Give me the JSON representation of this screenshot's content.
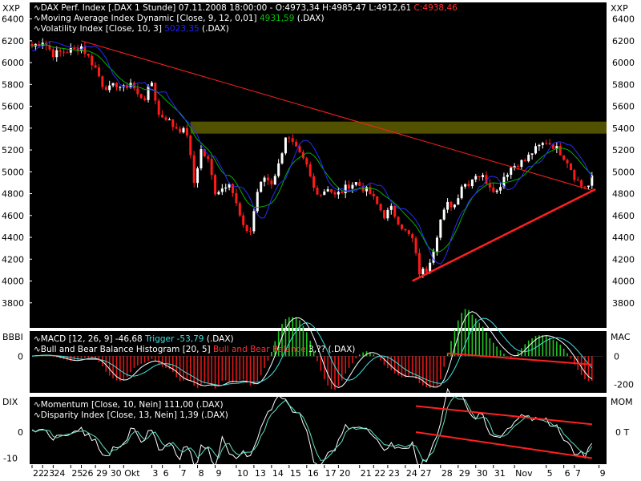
{
  "panel_codes": {
    "price_left": "XXP",
    "price_right": "XXP",
    "bb_left": "BBBI",
    "bb_right": "MAC",
    "mom_left": "DIX",
    "mom_right": "MOM"
  },
  "headers": {
    "price": [
      {
        "name": "DAX Perf. Index [.DAX  1 Stunde]",
        "info": " 07.11.2008 18:00:00 - O:4973,34 H:4985,47 L:4912,61 ",
        "last": "C:4938,46",
        "color": "#ffffff",
        "last_color": "#ff3030"
      },
      {
        "name": "Moving Average Index Dynamic [Close, 9, 12, 0,01]",
        "info": " ",
        "last": "4931,59",
        "color": "#ffffff",
        "last_color": "#00c800",
        "suffix": " (.DAX)"
      },
      {
        "name": "Volatility Index [Close, 10, 3]",
        "info": " ",
        "last": "5023,35",
        "color": "#ffffff",
        "last_color": "#2020ff",
        "suffix": " (.DAX)"
      }
    ],
    "bb": [
      {
        "name": "MACD [12, 26, 9]",
        "info": " -46,68 ",
        "last": "Trigger -53,79",
        "color": "#ffffff",
        "last_color": "#40e0e0",
        "suffix": " (.DAX)"
      },
      {
        "name": "Bull and Bear Balance Histogram [20, 5]",
        "info": " ",
        "last": "Bull and Bear Balance",
        "color": "#ffffff",
        "last_color": "#ff3030",
        "suffix": " 3,?? (.DAX)"
      }
    ],
    "mom": [
      {
        "name": "Momentum [Close, 10, Nein]",
        "info": " 111,00",
        "last": "",
        "color": "#ffffff",
        "last_color": "#ffffff",
        "suffix": " (.DAX)"
      },
      {
        "name": "Disparity Index [Close, 13, Nein]",
        "info": " 1,39",
        "last": "",
        "color": "#ffffff",
        "last_color": "#ffffff",
        "suffix": " (.DAX)"
      }
    ]
  },
  "chart_data": [
    {
      "type": "candlestick",
      "title": "DAX Perf. Index [.DAX  1 Stunde]",
      "ylim": [
        3600,
        6500
      ],
      "y_ticks": [
        "6400",
        "6200",
        "6000",
        "5800",
        "5600",
        "5400",
        "5200",
        "5000",
        "4800",
        "4600",
        "4400",
        "4200",
        "4000",
        "3800"
      ],
      "y_tick_values": [
        6400,
        6200,
        6000,
        5800,
        5600,
        5400,
        5200,
        5000,
        4800,
        4600,
        4400,
        4200,
        4000,
        3800
      ],
      "close_path": [
        [
          0,
          6150
        ],
        [
          3,
          6200
        ],
        [
          6,
          6080
        ],
        [
          9,
          6100
        ],
        [
          12,
          6120
        ],
        [
          14,
          6150
        ],
        [
          16,
          6050
        ],
        [
          18,
          5950
        ],
        [
          20,
          5800
        ],
        [
          22,
          5760
        ],
        [
          24,
          5800
        ],
        [
          26,
          5760
        ],
        [
          28,
          5820
        ],
        [
          30,
          5700
        ],
        [
          32,
          5680
        ],
        [
          34,
          5820
        ],
        [
          36,
          5520
        ],
        [
          38,
          5500
        ],
        [
          40,
          5420
        ],
        [
          42,
          5390
        ],
        [
          44,
          5350
        ],
        [
          46,
          4900
        ],
        [
          48,
          5200
        ],
        [
          50,
          5100
        ],
        [
          52,
          4820
        ],
        [
          54,
          4850
        ],
        [
          56,
          4920
        ],
        [
          58,
          4700
        ],
        [
          60,
          4480
        ],
        [
          62,
          4460
        ],
        [
          64,
          4820
        ],
        [
          66,
          4950
        ],
        [
          68,
          4900
        ],
        [
          70,
          5060
        ],
        [
          72,
          5330
        ],
        [
          74,
          5250
        ],
        [
          76,
          5150
        ],
        [
          78,
          5050
        ],
        [
          80,
          4850
        ],
        [
          82,
          4800
        ],
        [
          84,
          4860
        ],
        [
          86,
          4780
        ],
        [
          88,
          4820
        ],
        [
          90,
          4880
        ],
        [
          92,
          4900
        ],
        [
          94,
          4850
        ],
        [
          96,
          4800
        ],
        [
          98,
          4700
        ],
        [
          100,
          4600
        ],
        [
          102,
          4660
        ],
        [
          104,
          4550
        ],
        [
          106,
          4450
        ],
        [
          108,
          4380
        ],
        [
          110,
          4080
        ],
        [
          112,
          4100
        ],
        [
          114,
          4300
        ],
        [
          116,
          4560
        ],
        [
          118,
          4700
        ],
        [
          120,
          4700
        ],
        [
          122,
          4880
        ],
        [
          124,
          4900
        ],
        [
          126,
          4980
        ],
        [
          128,
          4950
        ],
        [
          130,
          4880
        ],
        [
          132,
          4820
        ],
        [
          134,
          4960
        ],
        [
          136,
          5040
        ],
        [
          138,
          5080
        ],
        [
          140,
          5100
        ],
        [
          142,
          5180
        ],
        [
          144,
          5230
        ],
        [
          146,
          5280
        ],
        [
          148,
          5240
        ],
        [
          150,
          5180
        ],
        [
          152,
          5100
        ],
        [
          154,
          4960
        ],
        [
          156,
          4870
        ],
        [
          158,
          4870
        ],
        [
          159,
          4938
        ]
      ],
      "horizontal_band": [
        5350,
        5460
      ],
      "trendlines": [
        {
          "from": [
            14,
            6200
          ],
          "to": [
            159,
            4830
          ],
          "color": "#ff2020"
        },
        {
          "from": [
            108,
            4000
          ],
          "to": [
            160,
            4840
          ],
          "color": "#ff2020"
        }
      ],
      "series": [
        {
          "name": "Moving Average Index Dynamic [Close, 9, 12, 0,01]",
          "color": "#00b000"
        },
        {
          "name": "Volatility Index [Close, 10, 3]",
          "color": "#2a2aff"
        }
      ]
    },
    {
      "type": "bar",
      "title": "MACD [12, 26, 9] / Bull and Bear Balance Histogram [20, 5]",
      "ylim": [
        -250,
        150
      ],
      "y_ticks": [
        "0"
      ],
      "y_tick_values": [
        0
      ],
      "right_ticks": [
        "0",
        "-200"
      ],
      "right_tick_values": [
        0,
        -200
      ],
      "trendline": {
        "from": [
          118,
          20
        ],
        "to": [
          159,
          -60
        ],
        "color": "#ff2020"
      }
    },
    {
      "type": "line",
      "title": "Momentum [Close, 10, Nein] / Disparity Index [Close, 13, Nein]",
      "ylim": [
        -12,
        12
      ],
      "y_ticks": [
        "0",
        "-10"
      ],
      "y_tick_values": [
        0,
        -10
      ],
      "right_ticks": [
        "0 T"
      ],
      "right_tick_values": [
        0
      ],
      "trendlines": [
        {
          "from": [
            109,
            10
          ],
          "to": [
            159,
            3
          ],
          "color": "#ff2020"
        },
        {
          "from": [
            109,
            0
          ],
          "to": [
            159,
            -10
          ],
          "color": "#ff2020"
        }
      ],
      "series": [
        {
          "name": "Momentum [Close, 10, Nein]",
          "color": "#ffffff"
        },
        {
          "name": "Disparity Index [Close, 13, Nein]",
          "color": "#60e0c0"
        }
      ]
    }
  ],
  "x_axis": {
    "labels": [
      "22",
      "23",
      "24",
      "25",
      "26",
      "29",
      "30",
      "Okt",
      "3",
      "6",
      "7",
      "8",
      "9",
      "10",
      "13",
      "14",
      "15",
      "16",
      "17",
      "20",
      "21",
      "22",
      "23",
      "24",
      "27",
      "28",
      "29",
      "30",
      "31",
      "Nov",
      "5",
      "6",
      "7",
      "9"
    ],
    "label_bars": [
      0,
      3,
      6,
      11,
      14,
      18,
      22,
      26,
      34,
      37,
      42,
      47,
      52,
      58,
      63,
      68,
      73,
      78,
      83,
      87,
      93,
      97,
      101,
      106,
      110,
      116,
      121,
      126,
      131,
      137,
      146,
      151,
      154,
      161
    ]
  }
}
